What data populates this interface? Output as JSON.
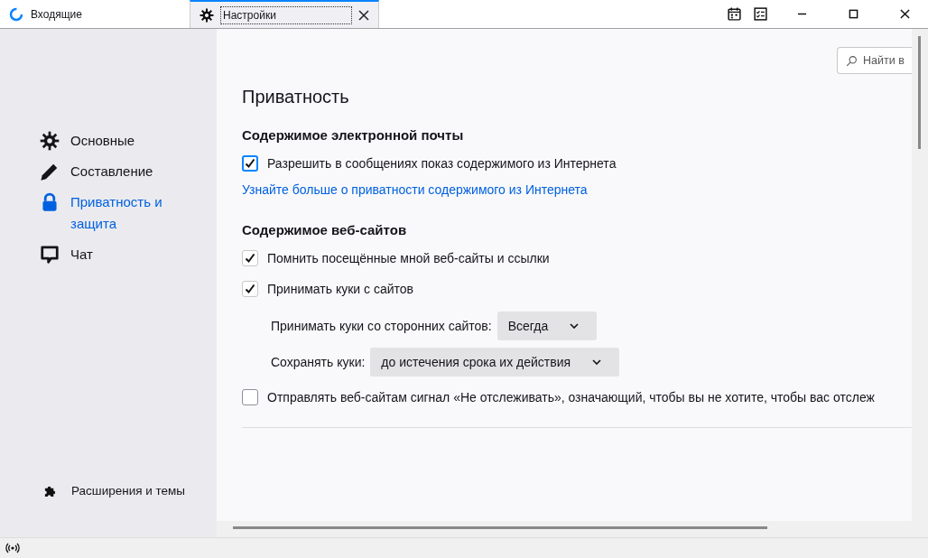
{
  "tabs": [
    {
      "label": "Входящие",
      "kind": "mail",
      "selected": false
    },
    {
      "label": "Настройки",
      "kind": "settings",
      "selected": true
    }
  ],
  "sidebar": {
    "items": [
      {
        "label": "Основные",
        "kind": "gear",
        "selected": false
      },
      {
        "label": "Составление",
        "kind": "pencil",
        "selected": false
      },
      {
        "label": "Приватность и защита",
        "kind": "lock",
        "selected": true
      },
      {
        "label": "Чат",
        "kind": "chat",
        "selected": false
      }
    ],
    "footer_item": {
      "label": "Расширения и темы"
    }
  },
  "search": {
    "placeholder": "Найти в"
  },
  "page_title": "Приватность",
  "sections": [
    {
      "heading": "Содержимое электронной почты",
      "rows": [
        {
          "kind": "checkbox",
          "label": "Разрешить в сообщениях показ содержимого из Интернета",
          "checked": true
        },
        {
          "kind": "link",
          "label": "Узнайте больше о приватности содержимого из Интернета"
        }
      ]
    },
    {
      "heading": "Содержимое веб-сайтов",
      "rows": [
        {
          "kind": "checkbox",
          "label": "Помнить посещённые мной веб-сайты и ссылки",
          "checked": true
        },
        {
          "kind": "checkbox",
          "label": "Принимать куки с сайтов",
          "checked": true
        },
        {
          "kind": "select",
          "label": "Принимать куки со сторонних сайтов:",
          "value": "Всегда"
        },
        {
          "kind": "select",
          "label": "Сохранять куки:",
          "value": "до истечения срока их действия"
        },
        {
          "kind": "checkbox",
          "label": "Отправлять веб-сайтам сигнал «Не отслеживать», означающий, чтобы вы не хотите, чтобы вас отслеж",
          "checked": false
        }
      ]
    }
  ]
}
